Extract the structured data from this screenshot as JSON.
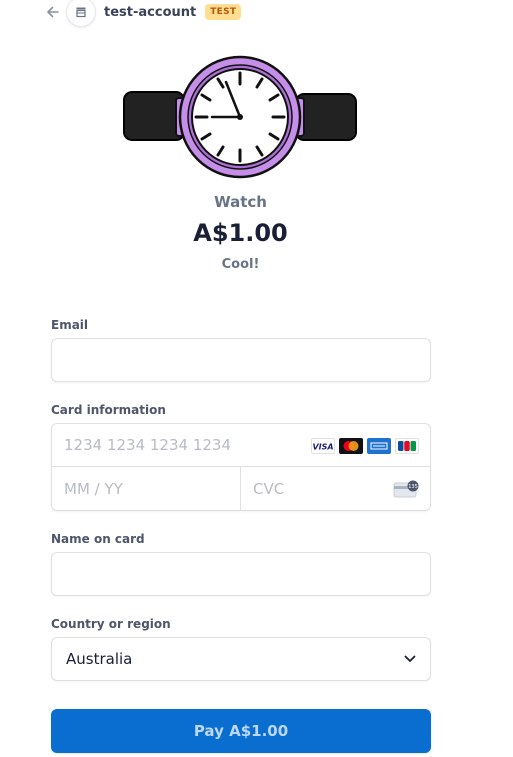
{
  "header": {
    "account_name": "test-account",
    "mode_badge": "TEST"
  },
  "product": {
    "name": "Watch",
    "price": "A$1.00",
    "description": "Cool!"
  },
  "form": {
    "email": {
      "label": "Email",
      "value": "",
      "placeholder": ""
    },
    "card": {
      "label": "Card information",
      "number_placeholder": "1234 1234 1234 1234",
      "expiry_placeholder": "MM / YY",
      "cvc_placeholder": "CVC",
      "brands": [
        "visa",
        "mastercard",
        "amex",
        "jcb"
      ]
    },
    "name_on_card": {
      "label": "Name on card",
      "value": "",
      "placeholder": ""
    },
    "country": {
      "label": "Country or region",
      "selected": "Australia"
    }
  },
  "pay_button": {
    "label": "Pay A$1.00"
  },
  "colors": {
    "accent": "#0a6ed1",
    "test_badge_bg": "#ffde92",
    "test_badge_text": "#bb5504",
    "watch_purple": "#c58ee8"
  }
}
